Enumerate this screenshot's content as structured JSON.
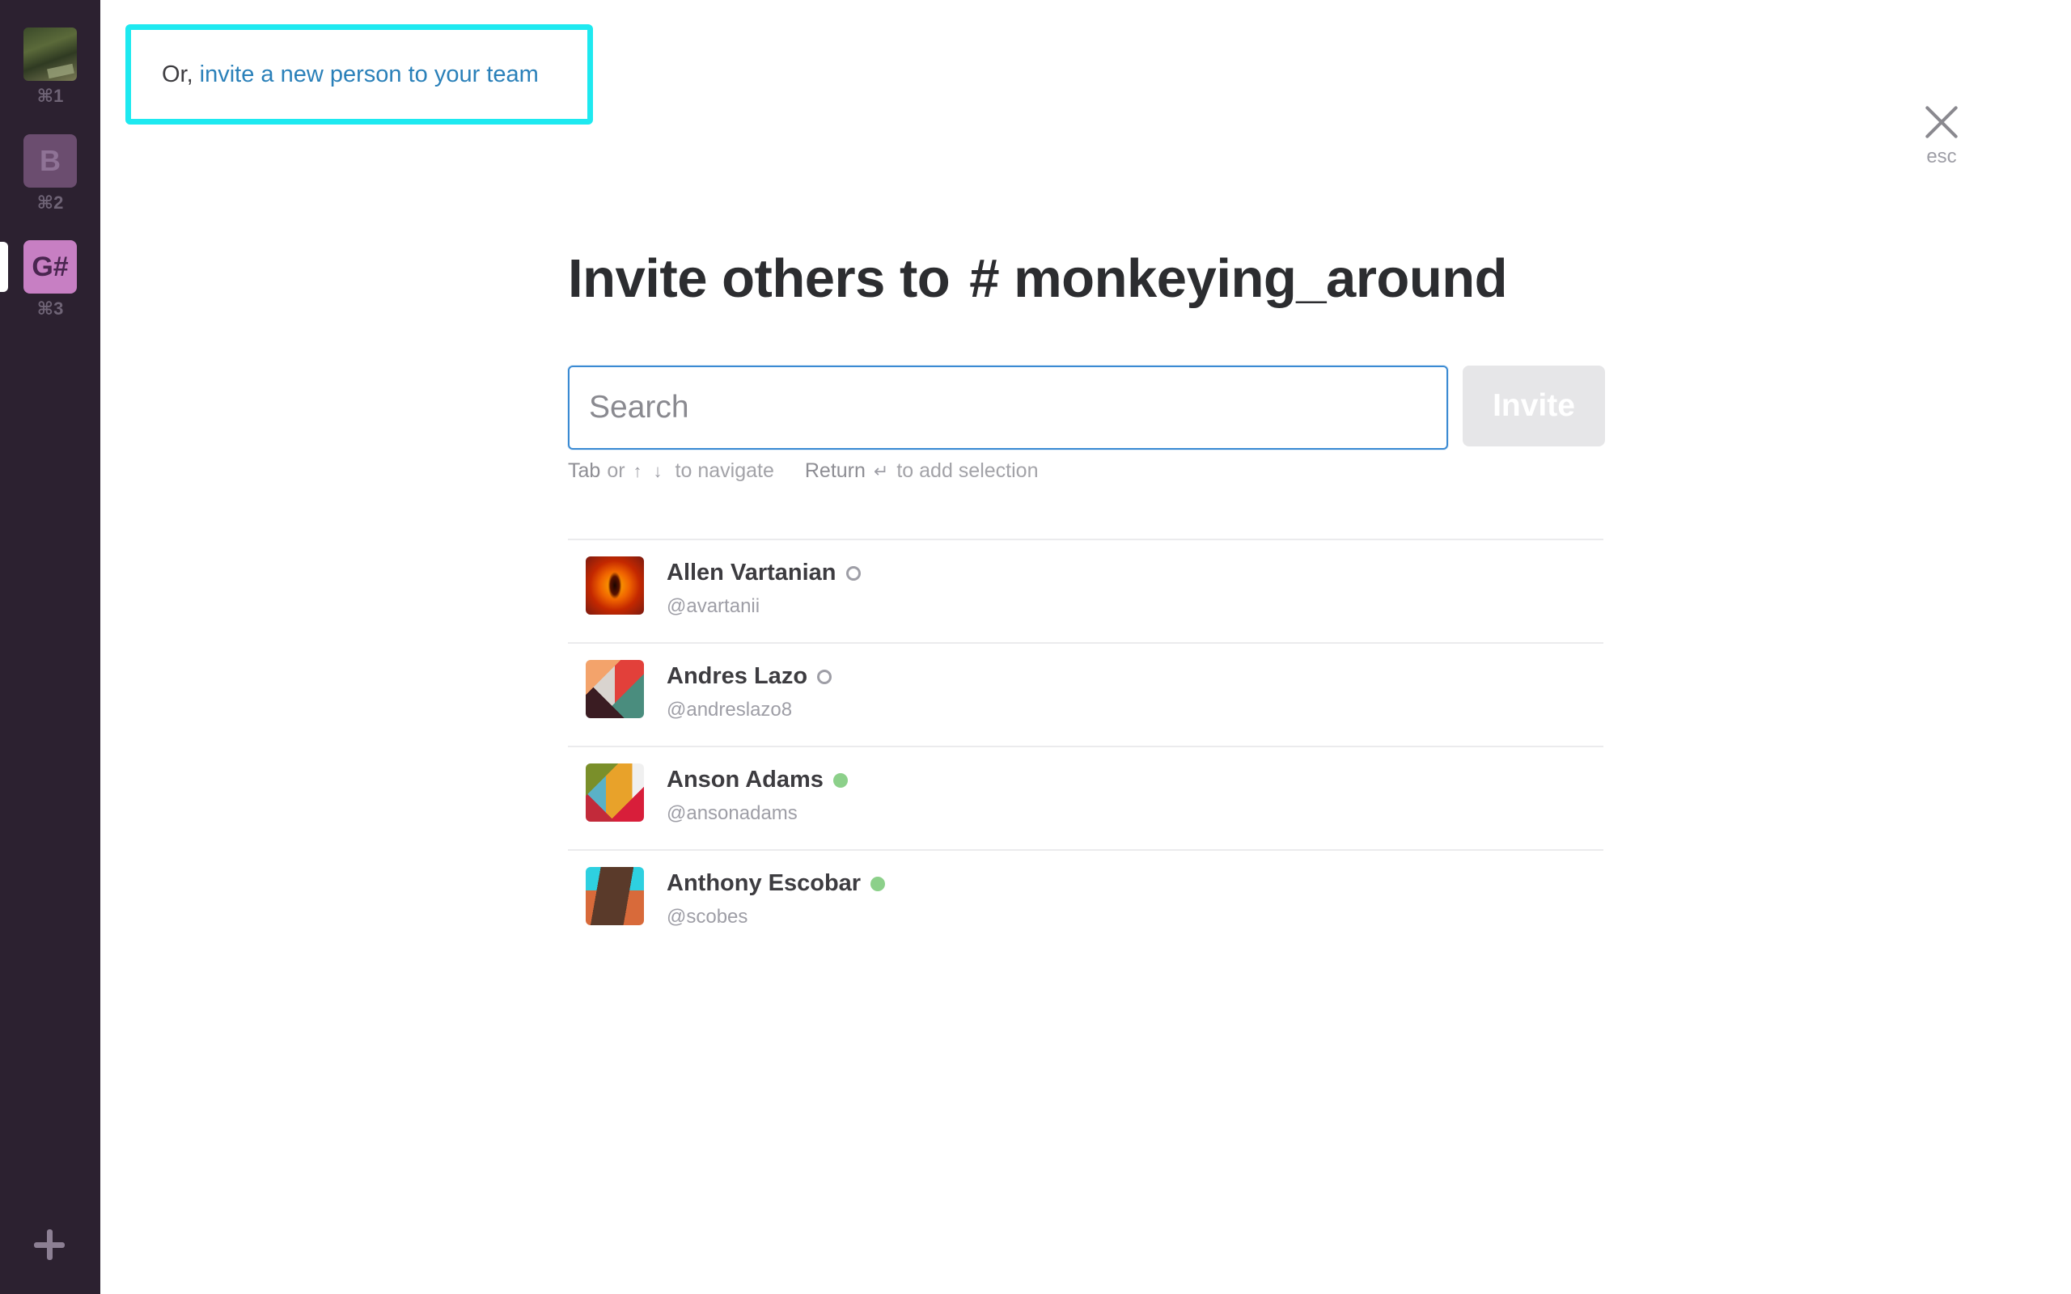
{
  "sidebar": {
    "teams": [
      {
        "initial": "",
        "shortcut": "⌘1",
        "image": "team-photo"
      },
      {
        "initial": "B",
        "shortcut": "⌘2",
        "color": "#6b4d6f"
      },
      {
        "initial": "G#",
        "shortcut": "⌘3",
        "color": "#c77fc3",
        "active": true
      }
    ],
    "add_icon": "plus-icon"
  },
  "callout": {
    "prefix": "Or,",
    "link": "invite a new person to your team"
  },
  "close": {
    "icon": "close-icon",
    "label": "esc"
  },
  "title": {
    "text": "Invite others to",
    "channel": "# monkeying_around"
  },
  "search": {
    "placeholder": "Search",
    "value": ""
  },
  "invite_button": "Invite",
  "hint": {
    "tab": "Tab",
    "or": "or",
    "navigate": "to navigate",
    "return": "Return",
    "add": "to add selection"
  },
  "members": [
    {
      "name": "Allen Vartanian",
      "handle": "@avartanii",
      "presence": "away"
    },
    {
      "name": "Andres Lazo",
      "handle": "@andreslazo8",
      "presence": "away"
    },
    {
      "name": "Anson Adams",
      "handle": "@ansonadams",
      "presence": "active"
    },
    {
      "name": "Anthony Escobar",
      "handle": "@scobes",
      "presence": "active"
    }
  ],
  "colors": {
    "sidebar_bg": "#2c2130",
    "callout_border": "#1ee9f0",
    "link": "#2a80b9",
    "focus": "#3a8ad3",
    "active_presence": "#8cd08a"
  }
}
